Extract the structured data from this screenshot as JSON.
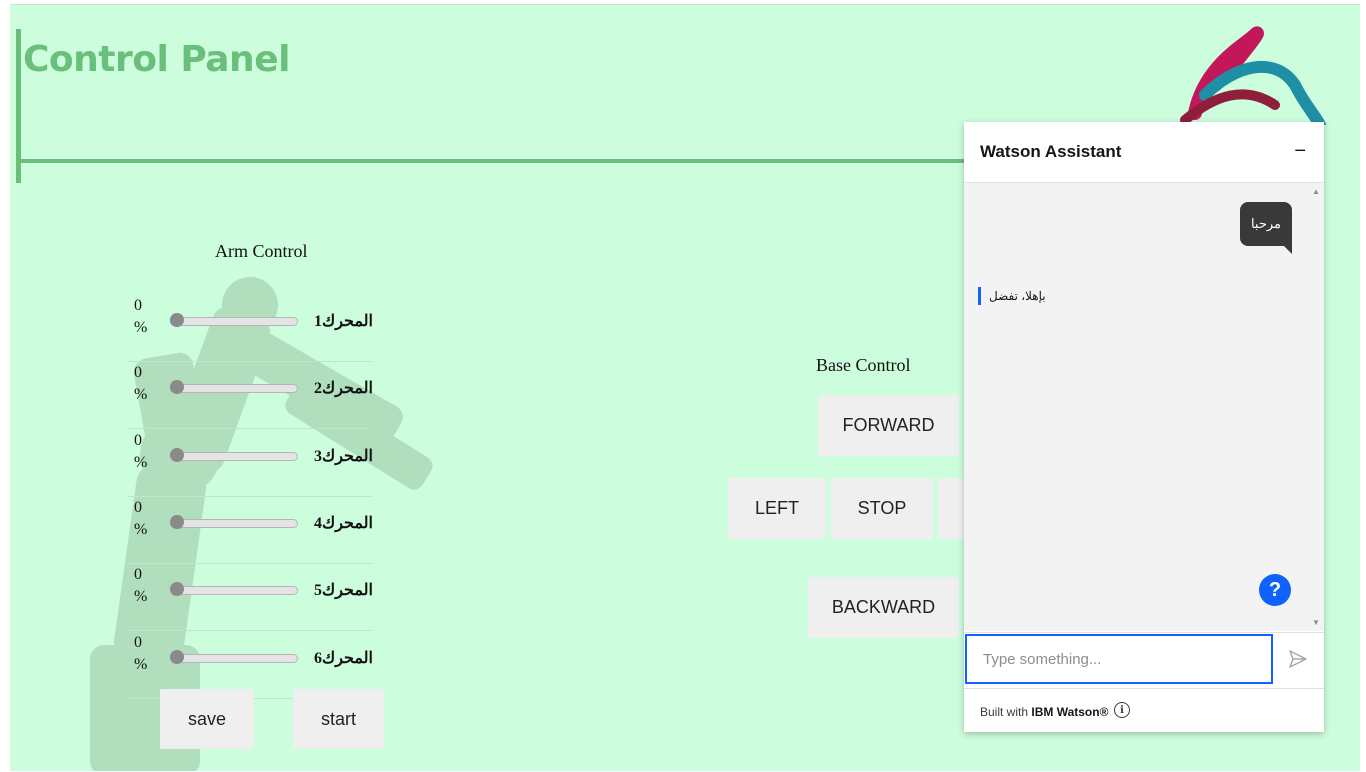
{
  "header": {
    "title": "Control Panel"
  },
  "arm_control": {
    "title": "Arm Control",
    "motors": [
      {
        "label": "المحرك1",
        "percent_text": "0",
        "percent_sign": "%",
        "value": 0
      },
      {
        "label": "المحرك2",
        "percent_text": "0",
        "percent_sign": "%",
        "value": 0
      },
      {
        "label": "المحرك3",
        "percent_text": "0",
        "percent_sign": "%",
        "value": 0
      },
      {
        "label": "المحرك4",
        "percent_text": "0",
        "percent_sign": "%",
        "value": 0
      },
      {
        "label": "المحرك5",
        "percent_text": "0",
        "percent_sign": "%",
        "value": 0
      },
      {
        "label": "المحرك6",
        "percent_text": "0",
        "percent_sign": "%",
        "value": 0
      }
    ],
    "save_label": "save",
    "start_label": "start"
  },
  "base_control": {
    "title": "Base Control",
    "forward_label": "FORWARD",
    "left_label": "LEFT",
    "stop_label": "STOP",
    "backward_label": "BACKWARD"
  },
  "watson": {
    "title": "Watson Assistant",
    "minimize_label": "−",
    "user_message": "مرحبا",
    "bot_message": "بإهلا، تفضل",
    "help_label": "?",
    "input_placeholder": "Type something...",
    "footer_prefix": "Built with",
    "footer_brand": "IBM Watson®",
    "info_label": "i"
  },
  "colors": {
    "page_background": "#ccfddc",
    "accent_green": "#6abf7b",
    "watson_blue": "#0f62fe"
  }
}
